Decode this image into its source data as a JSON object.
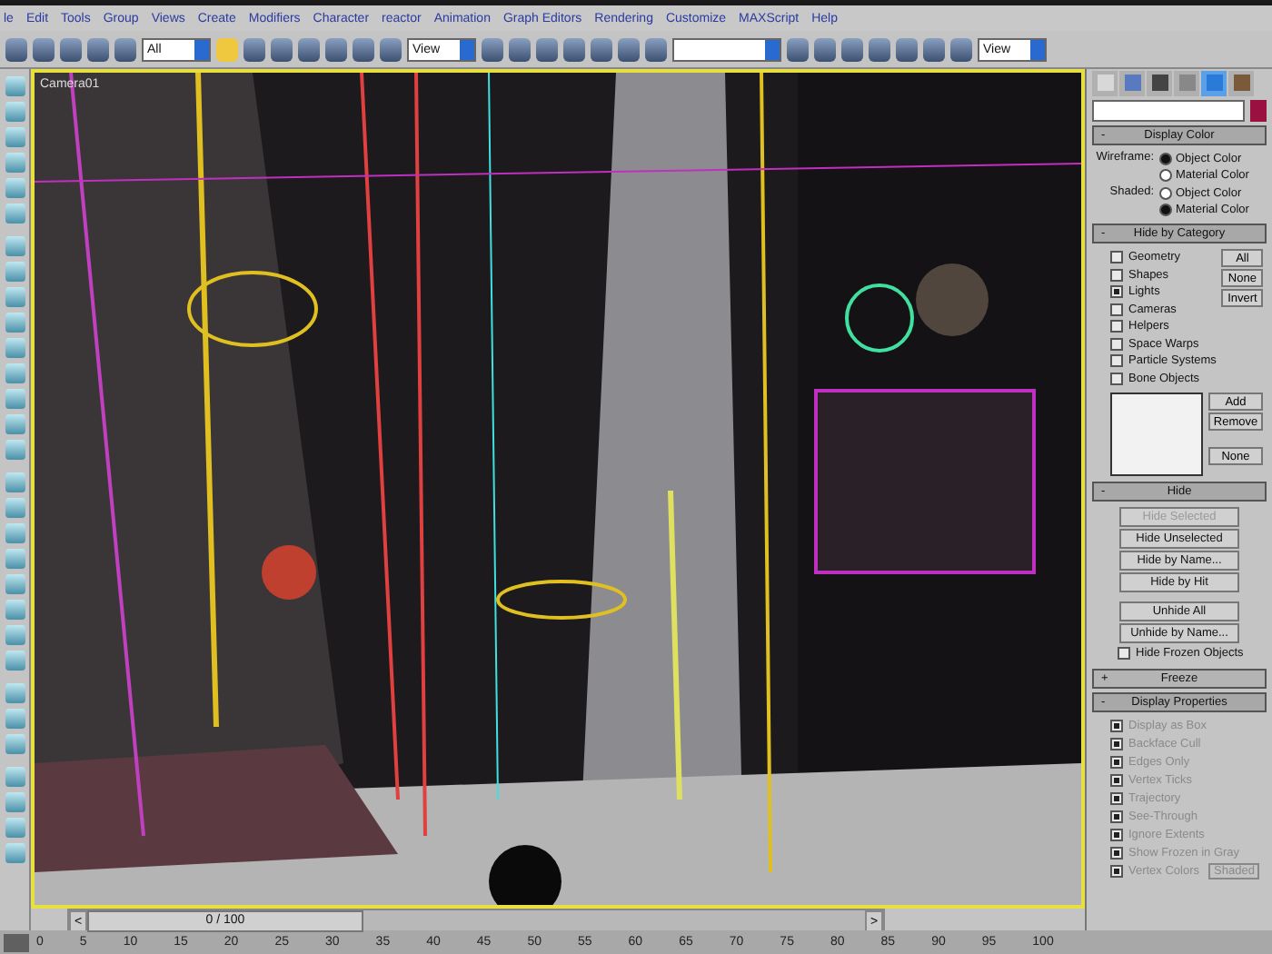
{
  "menu": [
    {
      "label": "le"
    },
    {
      "label": "Edit"
    },
    {
      "label": "Tools"
    },
    {
      "label": "Group"
    },
    {
      "label": "Views"
    },
    {
      "label": "Create"
    },
    {
      "label": "Modifiers"
    },
    {
      "label": "Character"
    },
    {
      "label": "reactor"
    },
    {
      "label": "Animation"
    },
    {
      "label": "Graph Editors"
    },
    {
      "label": "Rendering"
    },
    {
      "label": "Customize"
    },
    {
      "label": "MAXScript"
    },
    {
      "label": "Help"
    }
  ],
  "toolbar": {
    "selection_filter": "All",
    "reference_coord": "View",
    "render_view": "View"
  },
  "viewport": {
    "label": "Camera01",
    "active": true
  },
  "command_panel": {
    "tabs": [
      {
        "kind": "create",
        "selected": false
      },
      {
        "kind": "modify",
        "selected": false
      },
      {
        "kind": "hierarchy",
        "selected": false
      },
      {
        "kind": "motion",
        "selected": false
      },
      {
        "kind": "display",
        "selected": true
      },
      {
        "kind": "utilities",
        "selected": false
      }
    ],
    "rollouts": [
      {
        "kind": "display_color",
        "title": "Display Color",
        "sign": "-",
        "expanded": true,
        "groups": [
          {
            "label": "Wireframe:",
            "options": [
              {
                "label": "Object Color",
                "selected": true
              },
              {
                "label": "Material Color",
                "selected": false
              }
            ]
          },
          {
            "label": "Shaded:",
            "options": [
              {
                "label": "Object Color",
                "selected": false
              },
              {
                "label": "Material Color",
                "selected": true
              }
            ]
          }
        ]
      },
      {
        "kind": "hide_by_category",
        "title": "Hide by Category",
        "sign": "-",
        "expanded": true,
        "checks": [
          {
            "label": "Geometry",
            "checked": false
          },
          {
            "label": "Shapes",
            "checked": false
          },
          {
            "label": "Lights",
            "checked": true
          },
          {
            "label": "Cameras",
            "checked": false
          },
          {
            "label": "Helpers",
            "checked": false
          },
          {
            "label": "Space Warps",
            "checked": false
          },
          {
            "label": "Particle Systems",
            "checked": false
          },
          {
            "label": "Bone Objects",
            "checked": false
          }
        ],
        "buttons": [
          "All",
          "None",
          "Invert"
        ],
        "list_buttons": [
          "Add",
          "Remove",
          "None"
        ]
      },
      {
        "kind": "hide",
        "title": "Hide",
        "sign": "-",
        "expanded": true,
        "buttons": [
          {
            "label": "Hide Selected",
            "disabled": true
          },
          {
            "label": "Hide Unselected",
            "disabled": false
          },
          {
            "label": "Hide by Name...",
            "disabled": false
          },
          {
            "label": "Hide by Hit",
            "disabled": false
          }
        ],
        "buttons2": [
          {
            "label": "Unhide All",
            "disabled": false
          },
          {
            "label": "Unhide by Name...",
            "disabled": false
          }
        ],
        "checks": [
          {
            "label": "Hide Frozen Objects",
            "checked": false
          }
        ]
      },
      {
        "kind": "freeze",
        "title": "Freeze",
        "sign": "+",
        "expanded": false
      },
      {
        "kind": "display_properties",
        "title": "Display Properties",
        "sign": "-",
        "expanded": true,
        "checks": [
          {
            "label": "Display as Box",
            "checked": true,
            "disabled": true
          },
          {
            "label": "Backface Cull",
            "checked": true,
            "disabled": true
          },
          {
            "label": "Edges Only",
            "checked": true,
            "disabled": true
          },
          {
            "label": "Vertex Ticks",
            "checked": true,
            "disabled": true
          },
          {
            "label": "Trajectory",
            "checked": true,
            "disabled": true
          },
          {
            "label": "See-Through",
            "checked": true,
            "disabled": true
          },
          {
            "label": "Ignore Extents",
            "checked": true,
            "disabled": true
          },
          {
            "label": "Show Frozen in Gray",
            "checked": true,
            "disabled": true
          },
          {
            "label": "Vertex Colors",
            "checked": true,
            "disabled": true,
            "button": "Shaded"
          }
        ]
      }
    ]
  },
  "time_slider": {
    "label": "0 / 100",
    "prev": "<",
    "next": ">",
    "level": 0
  },
  "ruler": [
    "0",
    "5",
    "10",
    "15",
    "20",
    "25",
    "30",
    "35",
    "40",
    "45",
    "50",
    "55",
    "60",
    "65",
    "70",
    "75",
    "80",
    "85",
    "90",
    "95",
    "100"
  ]
}
